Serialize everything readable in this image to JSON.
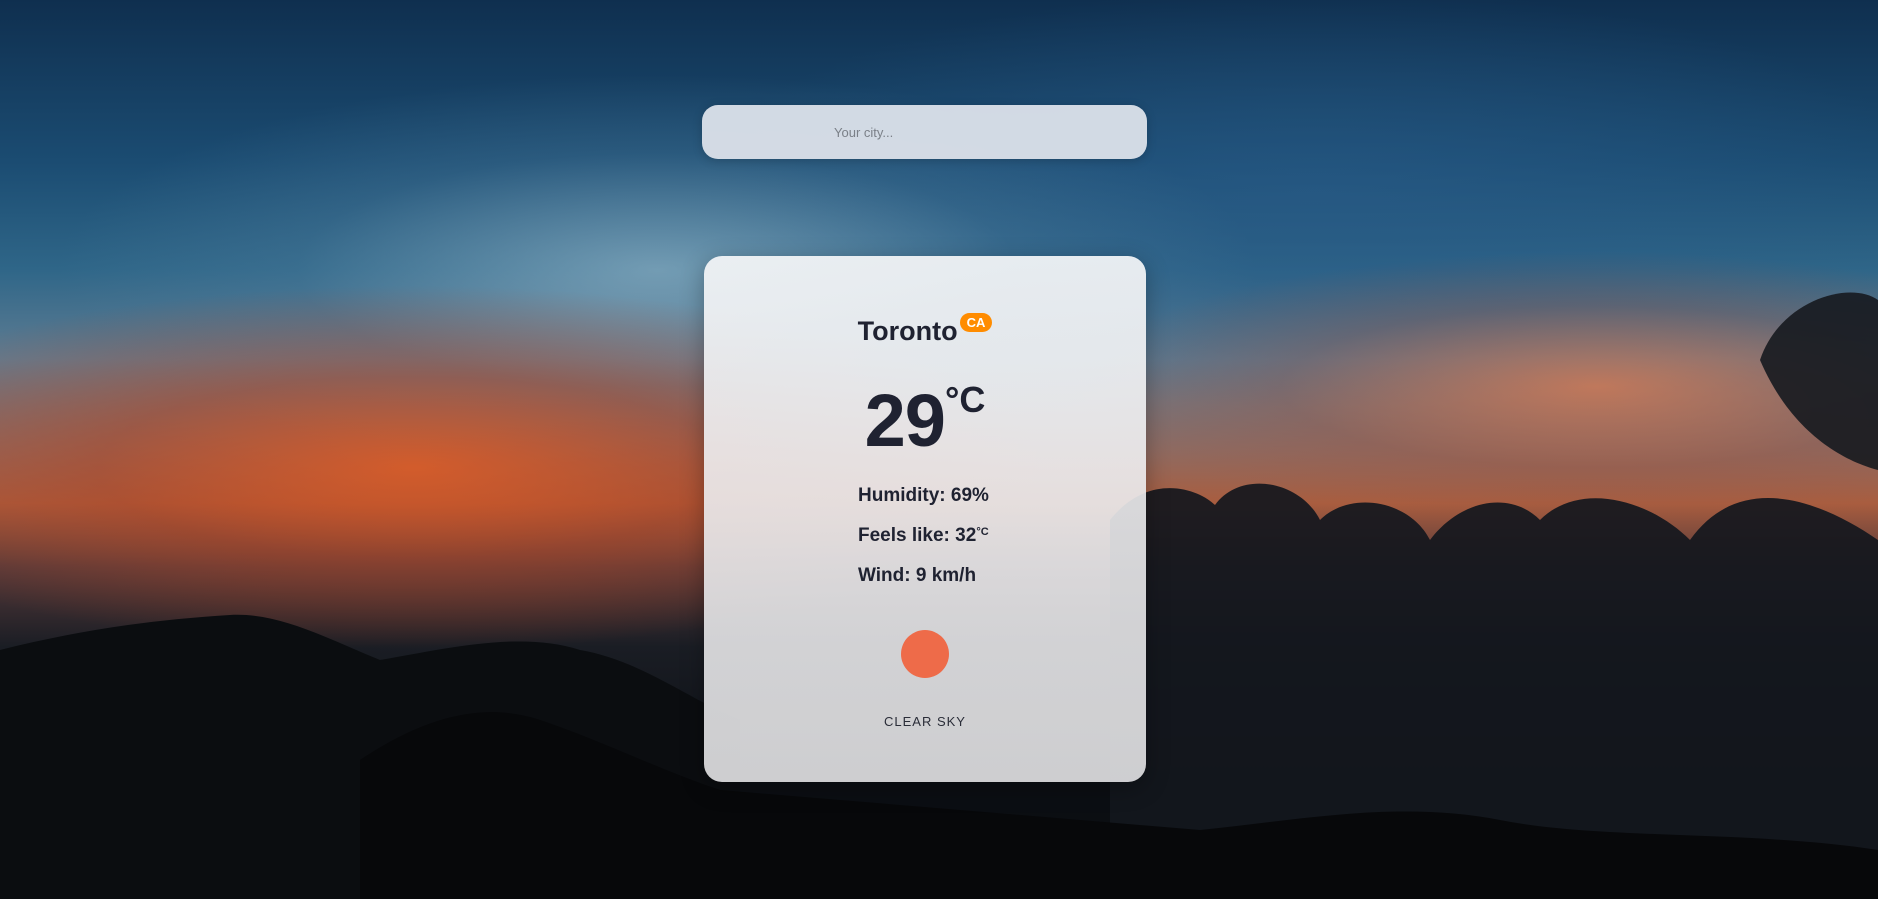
{
  "search": {
    "placeholder": "Your city...",
    "value": ""
  },
  "weather": {
    "city": "Toronto",
    "country": "CA",
    "temperature": "29",
    "temperature_unit": "°C",
    "humidity_label": "Humidity:",
    "humidity_value": "69%",
    "feels_like_label": "Feels like:",
    "feels_like_value": "32",
    "feels_like_unit": "°C",
    "wind_label": "Wind:",
    "wind_value": "9 km/h",
    "description": "CLEAR SKY",
    "icon": "sun-icon"
  },
  "colors": {
    "badge": "#ff8c00",
    "sun": "#ee6b49",
    "text": "#1f2231"
  }
}
